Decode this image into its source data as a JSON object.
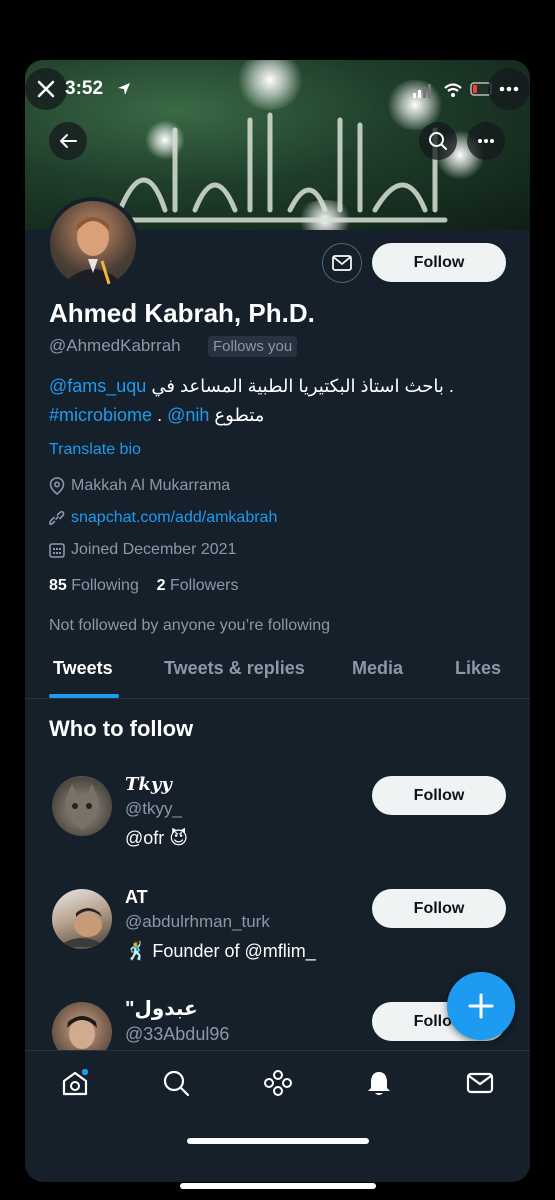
{
  "status": {
    "time": "3:52"
  },
  "profile": {
    "name": "Ahmed Kabrah, Ph.D.",
    "handle": "@AhmedKabrrah",
    "follows_you": "Follows you",
    "bio_line1_text": "استاذ البكتيريا الطبية المساعد في",
    "bio_line1_link": "@fams_uqu",
    "bio_line1_tail": ". باحث",
    "bio_line2_hashtag": "#microbiome",
    "bio_line2_dot": ".",
    "bio_line2_link": "@nih",
    "bio_line2_text": "متطوع",
    "translate": "Translate bio",
    "location": "Makkah Al Mukarrama",
    "website": "snapchat.com/add/amkabrah",
    "joined": "Joined December 2021",
    "following_count": "85",
    "following_label": "Following",
    "followers_count": "2",
    "followers_label": "Followers",
    "not_followed": "Not followed by anyone you’re following",
    "follow_label": "Follow"
  },
  "tabs": [
    "Tweets",
    "Tweets & replies",
    "Media",
    "Likes"
  ],
  "who_to_follow": {
    "title": "Who to follow",
    "users": [
      {
        "name": "𝑻𝒌𝒚𝒚",
        "handle": "@tkyy_",
        "bio": "@ofr 😈",
        "follow": "Follow"
      },
      {
        "name": "AT",
        "handle": "@abdulrhman_turk",
        "bio": "🕺 Founder of @mflim_",
        "follow": "Follow"
      },
      {
        "name": "\"عبدول",
        "handle": "@33Abdul96",
        "bio": "",
        "follow": "Follow"
      }
    ]
  },
  "colors": {
    "background": "#15202b",
    "accent": "#1d9bf0",
    "muted": "#8b98a5"
  }
}
